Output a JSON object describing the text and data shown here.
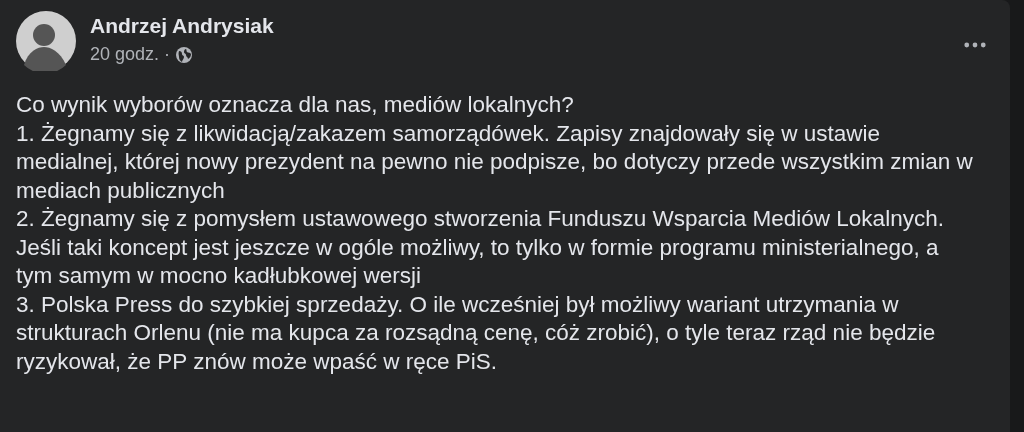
{
  "post": {
    "author": "Andrzej Andrysiak",
    "time": "20 godz.",
    "separator": "·",
    "paragraphs": [
      "Co wynik wyborów oznacza dla nas, mediów lokalnych?",
      "1. Żegnamy się z likwidacją/zakazem samorządówek. Zapisy znajdowały się w ustawie medialnej, której nowy prezydent na pewno nie podpisze, bo dotyczy przede wszystkim zmian w mediach publicznych",
      "2. Żegnamy się z pomysłem ustawowego stworzenia Funduszu Wsparcia Mediów Lokalnych. Jeśli taki koncept jest jeszcze w ogóle możliwy, to tylko w formie programu ministerialnego, a tym samym w mocno kadłubkowej wersji",
      "3. Polska Press do szybkiej sprzedaży. O ile wcześniej był możliwy wariant utrzymania w strukturach Orlenu (nie ma kupca za rozsądną cenę, cóż zrobić), o tyle teraz rząd nie będzie ryzykował, że PP znów może wpaść w ręce PiS."
    ]
  }
}
